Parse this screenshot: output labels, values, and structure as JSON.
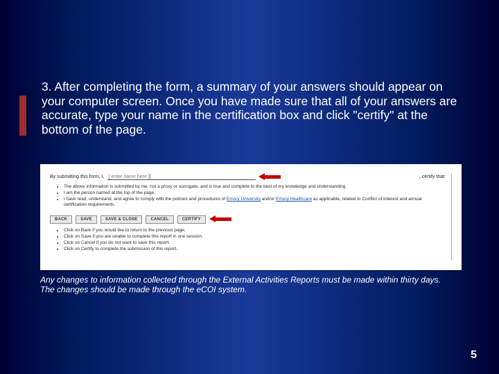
{
  "main_text": "3. After completing the form,  a summary of your answers should appear on your computer screen. Once you have made sure that all of your answers are accurate, type your name in the certification box and click \"certify\" at the bottom of the page.",
  "screenshot": {
    "intro_prefix": "By submitting this form, I,",
    "name_placeholder": "[ enter name here ]",
    "intro_suffix": ", certify that:",
    "cert_bullets": [
      "The above information is submitted by me, not a proxy or surrogate, and is true and complete to the best of my knowledge and understanding.",
      "I am the person named at the top of the page.",
      "I have read, understand, and agree to comply with the policies and procedures of Emory University and/or Emory Healthcare as applicable, related to Conflict of Interest and annual certification requirements."
    ],
    "link1": "Emory University",
    "link2": "Emory Healthcare",
    "buttons": {
      "back": "BACK",
      "save": "SAVE",
      "save_close": "SAVE & CLOSE",
      "cancel": "CANCEL",
      "certify": "CERTIFY"
    },
    "instr_bullets": [
      "Click on Back if you would like to return to the previous page.",
      "Click on Save if you are unable to complete this report in one session.",
      "Click on Cancel if you do not want to save this report.",
      "Click on Certify to complete the submission of this report."
    ]
  },
  "footer_note_line1": "Any changes to information collected through the External Activities Reports must be made within thirty days.",
  "footer_note_line2": "The changes should be made through the eCOI system.",
  "page_number": "5"
}
